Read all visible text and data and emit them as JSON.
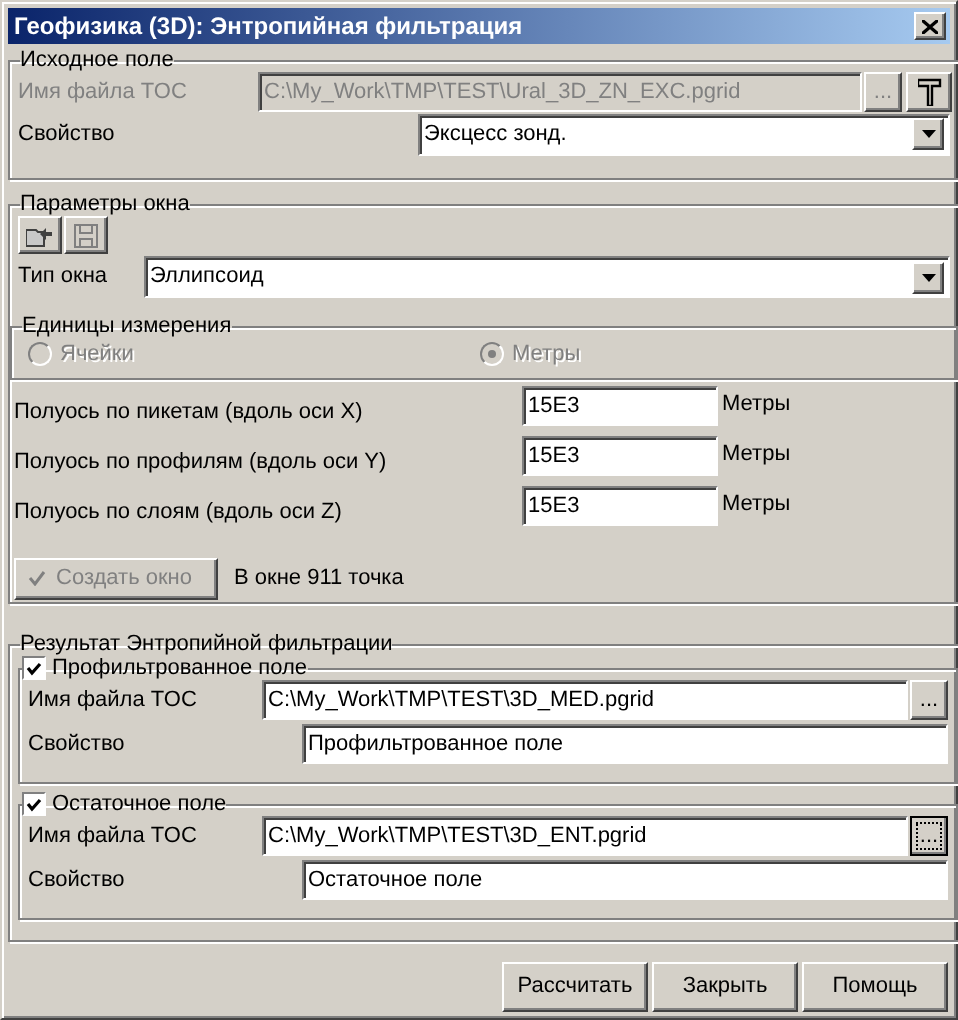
{
  "window": {
    "title": "Геофизика (3D): Энтропийная фильтрация"
  },
  "source": {
    "title": "Исходное поле",
    "file": {
      "label": "Имя файла TOC",
      "value": "C:\\My_Work\\TMP\\TEST\\Ural_3D_ZN_EXC.pgrid",
      "browse": "...",
      "disabled": true
    },
    "property": {
      "label": "Свойство",
      "value": "Эксцесс зонд."
    }
  },
  "window_params": {
    "title": "Параметры окна",
    "window_type": {
      "label": "Тип окна",
      "value": "Эллипсоид"
    },
    "units": {
      "title": "Единицы измерения",
      "disabled": true,
      "options": [
        {
          "label": "Ячейки",
          "selected": false
        },
        {
          "label": "Метры",
          "selected": true
        }
      ]
    },
    "semi_axes": [
      {
        "label": "Полуось по пикетам (вдоль оси X)",
        "value": "15E3",
        "unit": "Метры"
      },
      {
        "label": "Полуось по профилям (вдоль оси Y)",
        "value": "15E3",
        "unit": "Метры"
      },
      {
        "label": "Полуось по слоям (вдоль оси Z)",
        "value": "15E3",
        "unit": "Метры"
      }
    ],
    "create_button": {
      "label": "Создать окно",
      "disabled": true
    },
    "point_count": "В окне 911 точка"
  },
  "result": {
    "title": "Результат Энтропийной фильтрации",
    "outputs": [
      {
        "label": "Профильтрованное поле",
        "checked": true,
        "file_label": "Имя файла TOC",
        "file": "C:\\My_Work\\TMP\\TEST\\3D_MED.pgrid",
        "browse": "...",
        "browse_focused": false,
        "property_label": "Свойство",
        "property": "Профильтрованное поле"
      },
      {
        "label": "Остаточное поле",
        "checked": true,
        "file_label": "Имя файла TOC",
        "file": "C:\\My_Work\\TMP\\TEST\\3D_ENT.pgrid",
        "browse": "...",
        "browse_focused": true,
        "property_label": "Свойство",
        "property": "Остаточное поле"
      }
    ]
  },
  "buttons": [
    "Рассчитать",
    "Закрыть",
    "Помощь"
  ]
}
